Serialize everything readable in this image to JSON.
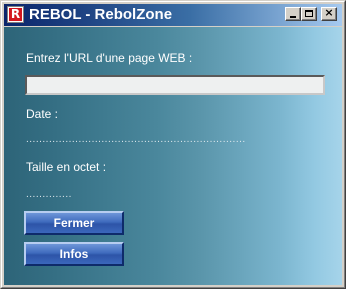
{
  "window": {
    "title": "REBOL - RebolZone",
    "icon_letter": "R",
    "controls": {
      "minimize": "minimize-icon",
      "maximize": "maximize-icon",
      "close": "×"
    }
  },
  "form": {
    "url_label": "Entrez l'URL d'une page WEB :",
    "url_value": "",
    "date_label": "Date :",
    "date_value": "...................................................................",
    "size_label": "Taille en octet :",
    "size_value": "..............",
    "close_button": "Fermer",
    "info_button": "Infos"
  },
  "colors": {
    "titlebar_start": "#0a246a",
    "titlebar_end": "#a6caf0",
    "button_blue": "#3f6bbd",
    "background_left": "#2d6478",
    "background_right": "#a6d4ea"
  }
}
